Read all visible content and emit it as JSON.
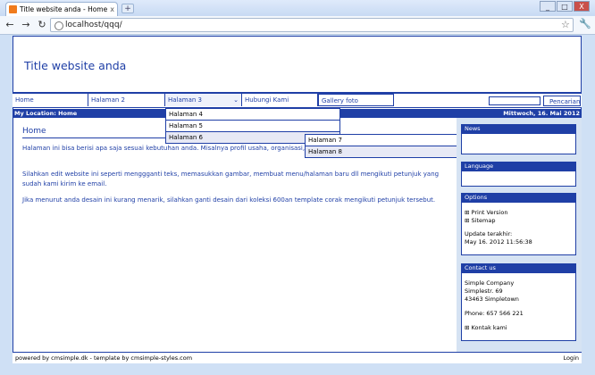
{
  "browser": {
    "tab_title": "Title website anda - Home",
    "tab_close": "x",
    "new_tab": "+",
    "url": "localhost/qqq/",
    "win_minimize": "_",
    "win_maximize": "□",
    "win_close": "X"
  },
  "site": {
    "title": "Title website anda",
    "menu": [
      "Home",
      "Halaman 2",
      "Halaman 3",
      "Hubungi Kami",
      "Gallery foto"
    ],
    "search_button": "Pencarian",
    "location": "My Location: Home",
    "date": "Mittwoch, 16. Mai 2012",
    "dropdown_level1": [
      "Halaman 4",
      "Halaman 5",
      "Halaman 6"
    ],
    "dropdown_level2": [
      "Halaman 7",
      "Halaman 8"
    ]
  },
  "content": {
    "heading": "Home",
    "p1": "Halaman ini bisa berisi apa saja sesuai kebutuhan anda. Misalnya profil usaha, organisasi, daftar produk, harga, atau informasi lainnya.",
    "p2": "Silahkan edit website ini seperti menggganti teks, memasukkan gambar, membuat menu/halaman baru dll mengikuti petunjuk yang sudah kami kirim ke email.",
    "p3": "Jika menurut anda desain ini kurang menarik, silahkan ganti desain dari koleksi 600an template corak mengikuti petunjuk tersebut."
  },
  "sidebar": {
    "news": "News",
    "language": "Language",
    "options": "Options",
    "print_version": "Print Version",
    "sitemap": "Sitemap",
    "update_label": "Update terakhir:",
    "update_value": "May 16. 2012 11:56:38",
    "contact_head": "Contact us",
    "company": "Simple Company",
    "street": "Simplestr. 69",
    "city": "43463 Simpletown",
    "phone": "Phone: 657 566 221",
    "contact_link": "Kontak kami"
  },
  "footer": {
    "powered": "powered by cmsimple.dk - template by cmsimple-styles.com",
    "login": "Login"
  },
  "colors": {
    "accent": "#1f3fa6",
    "sidebar_bg": "#d6e3f3"
  }
}
